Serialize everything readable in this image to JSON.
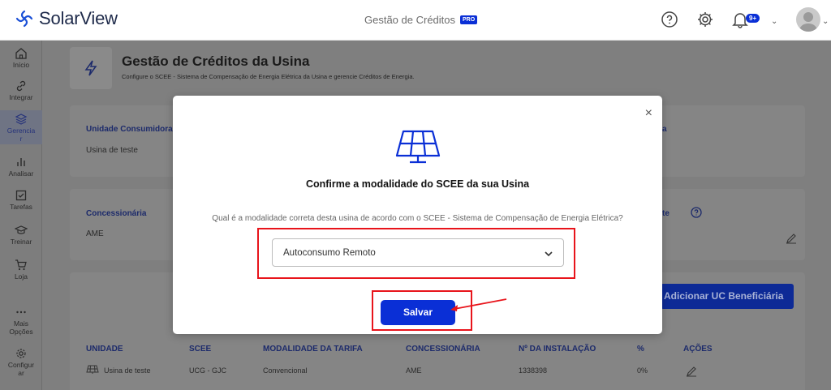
{
  "header": {
    "app_name": "SolarView",
    "section_title": "Gestão de Créditos",
    "pro_badge": "PRO",
    "notification_badge": "9+"
  },
  "sidebar": {
    "items": [
      {
        "label": "Início",
        "icon": "home-icon"
      },
      {
        "label": "Integrar",
        "icon": "link-icon"
      },
      {
        "label": "Gerencia\nr",
        "icon": "layers-icon",
        "active": true
      },
      {
        "label": "Analisar",
        "icon": "bar-chart-icon"
      },
      {
        "label": "Tarefas",
        "icon": "checkbox-icon"
      },
      {
        "label": "Treinar",
        "icon": "graduation-cap-icon"
      },
      {
        "label": "Loja",
        "icon": "cart-icon"
      },
      {
        "label": "Mais\nOpções",
        "icon": "more-icon"
      },
      {
        "label": "Configur\nar",
        "icon": "gear-icon"
      }
    ]
  },
  "page": {
    "title": "Gestão de Créditos da Usina",
    "subtitle": "Configure o SCEE - Sistema de Compensação de Energia Elétrica da Usina e gerencie Créditos de Energia.",
    "unidade_label": "Unidade Consumidora",
    "unidade_value": "Usina de teste",
    "concessionaria_label": "Concessionária",
    "concessionaria_value": "AME",
    "right_label_1": "a",
    "right_label_2": "te",
    "add_button": "Adicionar UC Beneficiária",
    "table": {
      "headers": [
        "UNIDADE",
        "SCEE",
        "MODALIDADE DA TARIFA",
        "CONCESSIONÁRIA",
        "Nº DA INSTALAÇÃO",
        "%",
        "AÇÕES"
      ],
      "rows": [
        [
          "Usina de teste",
          "UCG - GJC",
          "Convencional",
          "AME",
          "1338398",
          "0%"
        ]
      ]
    }
  },
  "modal": {
    "title": "Confirme a modalidade do SCEE da sua Usina",
    "question": "Qual é a modalidade correta desta usina de acordo com o SCEE - Sistema de Compensação de Energia Elétrica?",
    "select_value": "Autoconsumo Remoto",
    "save_label": "Salvar",
    "close_label": "×"
  },
  "colors": {
    "primary": "#0a2fd6",
    "highlight": "#e8141b",
    "overlay": "#7f7f7f"
  }
}
